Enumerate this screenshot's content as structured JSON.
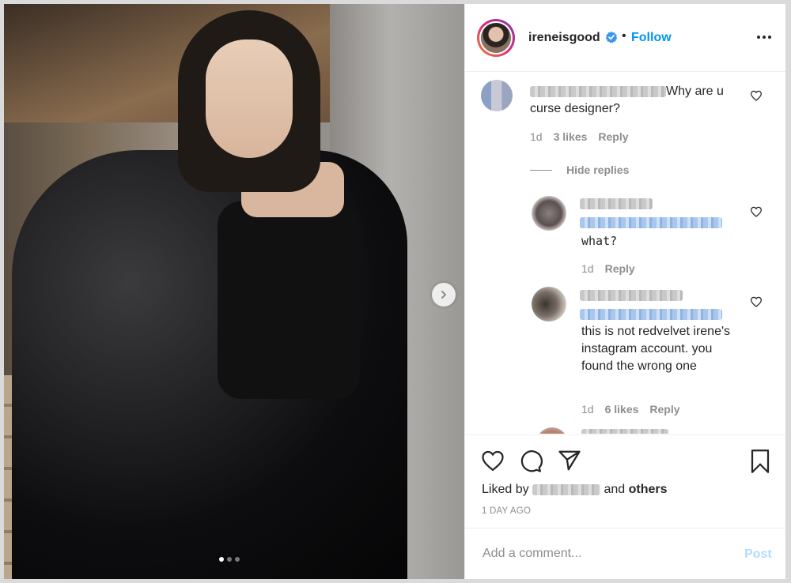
{
  "post": {
    "username": "ireneisgood",
    "follow_label": "Follow",
    "separator": "•",
    "image_alt": "Photo",
    "carousel": {
      "total": 3,
      "current": 1
    }
  },
  "comments": [
    {
      "text": "Why are u curse designer?",
      "time": "1d",
      "likes": "3 likes",
      "reply_label": "Reply",
      "hide_replies_label": "Hide replies"
    },
    {
      "text": "what?",
      "time": "1d",
      "reply_label": "Reply"
    },
    {
      "text": "this is not redvelvet irene's instagram account. you found the wrong one",
      "time": "1d",
      "likes": "6 likes",
      "reply_label": "Reply"
    }
  ],
  "engagement": {
    "liked_by_prefix": "Liked by",
    "liked_by_and": "and",
    "liked_by_others": "others",
    "time_ago": "1 DAY AGO"
  },
  "composer": {
    "placeholder": "Add a comment...",
    "post_label": "Post"
  },
  "colors": {
    "accent": "#0095f6",
    "post_disabled": "#b3dbff",
    "muted": "#8e8e8e"
  }
}
